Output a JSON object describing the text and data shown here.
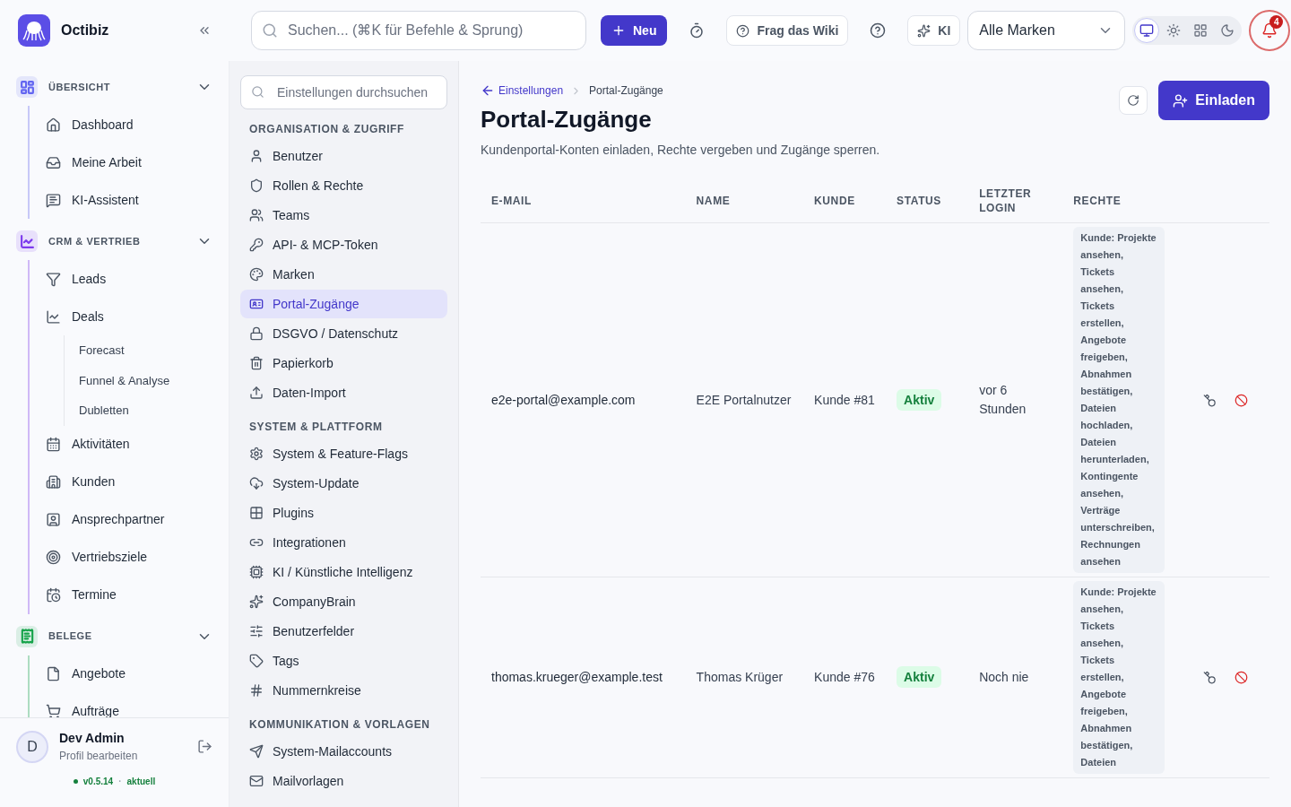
{
  "brand": {
    "name": "Octibiz"
  },
  "topbar": {
    "search_placeholder": "Suchen... (⌘K für Befehle & Sprung)",
    "new_button": "Neu",
    "wiki_button": "Frag das Wiki",
    "ki_button": "KI",
    "brand_select": "Alle Marken",
    "theme_options": [
      {
        "kind": "system",
        "selected": true
      },
      {
        "kind": "light",
        "selected": false
      },
      {
        "kind": "grid",
        "selected": false
      },
      {
        "kind": "dark",
        "selected": false
      }
    ],
    "notifications": "4"
  },
  "sidebar": {
    "sections": [
      {
        "title": "ÜBERSICHT",
        "expanded": true,
        "color": "#6366f1",
        "items": [
          {
            "label": "Dashboard"
          },
          {
            "label": "Meine Arbeit"
          },
          {
            "label": "KI-Assistent"
          }
        ]
      },
      {
        "title": "CRM & VERTRIEB",
        "expanded": true,
        "color": "#7c3aed",
        "items": [
          {
            "label": "Leads"
          },
          {
            "label": "Deals",
            "children": [
              {
                "label": "Forecast"
              },
              {
                "label": "Funnel & Analyse"
              },
              {
                "label": "Dubletten"
              }
            ]
          },
          {
            "label": "Aktivitäten"
          },
          {
            "label": "Kunden"
          },
          {
            "label": "Ansprechpartner"
          },
          {
            "label": "Vertriebsziele"
          },
          {
            "label": "Termine"
          }
        ]
      },
      {
        "title": "BELEGE",
        "expanded": true,
        "color": "#16a34a",
        "items": [
          {
            "label": "Angebote"
          },
          {
            "label": "Aufträge"
          }
        ]
      }
    ],
    "user": {
      "initial": "D",
      "name": "Dev Admin",
      "subtitle": "Profil bearbeiten"
    },
    "version": "v0.5.14",
    "version_separator": "·",
    "version_status": "aktuell"
  },
  "settings_nav": {
    "search_placeholder": "Einstellungen durchsuchen",
    "groups": [
      {
        "title": "ORGANISATION & ZUGRIFF",
        "items": [
          {
            "label": "Benutzer",
            "selected": false
          },
          {
            "label": "Rollen & Rechte",
            "selected": false
          },
          {
            "label": "Teams",
            "selected": false
          },
          {
            "label": "API- & MCP-Token",
            "selected": false
          },
          {
            "label": "Marken",
            "selected": false
          },
          {
            "label": "Portal-Zugänge",
            "selected": true
          },
          {
            "label": "DSGVO / Datenschutz",
            "selected": false
          },
          {
            "label": "Papierkorb",
            "selected": false
          },
          {
            "label": "Daten-Import",
            "selected": false
          }
        ]
      },
      {
        "title": "SYSTEM & PLATTFORM",
        "items": [
          {
            "label": "System & Feature-Flags",
            "selected": false
          },
          {
            "label": "System-Update",
            "selected": false
          },
          {
            "label": "Plugins",
            "selected": false
          },
          {
            "label": "Integrationen",
            "selected": false
          },
          {
            "label": "KI / Künstliche Intelligenz",
            "selected": false
          },
          {
            "label": "CompanyBrain",
            "selected": false
          },
          {
            "label": "Benutzerfelder",
            "selected": false
          },
          {
            "label": "Tags",
            "selected": false
          },
          {
            "label": "Nummernkreise",
            "selected": false
          }
        ]
      },
      {
        "title": "KOMMUNIKATION & VORLAGEN",
        "items": [
          {
            "label": "System-Mailaccounts",
            "selected": false
          },
          {
            "label": "Mailvorlagen",
            "selected": false
          }
        ]
      }
    ]
  },
  "page": {
    "breadcrumb": {
      "back": "Einstellungen",
      "current": "Portal-Zugänge"
    },
    "title": "Portal-Zugänge",
    "description": "Kundenportal-Konten einladen, Rechte vergeben und Zugänge sperren.",
    "invite_button": "Einladen",
    "table": {
      "columns": [
        "E-MAIL",
        "NAME",
        "KUNDE",
        "STATUS",
        "LETZTER LOGIN",
        "RECHTE"
      ],
      "rows": [
        {
          "email": "e2e-portal@example.com",
          "name": "E2E Portalnutzer",
          "customer": "Kunde #81",
          "status": "Aktiv",
          "last_login": "vor 6 Stunden",
          "rights": "Kunde: Projekte ansehen, Tickets ansehen, Tickets erstellen, Angebote freigeben, Abnahmen bestätigen, Dateien hochladen, Dateien herunterladen, Kontingente ansehen, Verträge unterschreiben, Rechnungen ansehen"
        },
        {
          "email": "thomas.krueger@example.test",
          "name": "Thomas Krüger",
          "customer": "Kunde #76",
          "status": "Aktiv",
          "last_login": "Noch nie",
          "rights": "Kunde: Projekte ansehen, Tickets ansehen, Tickets erstellen, Angebote freigeben, Abnahmen bestätigen, Dateien"
        }
      ]
    }
  }
}
